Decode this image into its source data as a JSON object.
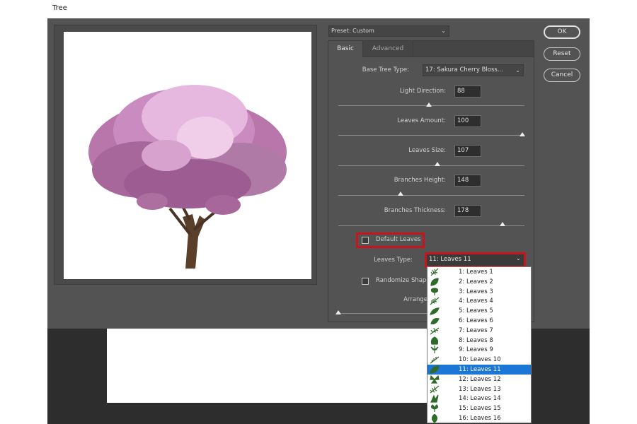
{
  "window": {
    "title": "Tree"
  },
  "buttons": {
    "ok": "OK",
    "reset": "Reset",
    "cancel": "Cancel"
  },
  "preset": {
    "label": "Preset: Custom"
  },
  "tabs": [
    {
      "label": "Basic",
      "active": true
    },
    {
      "label": "Advanced",
      "active": false
    }
  ],
  "basic": {
    "base_tree_type": {
      "label": "Base Tree Type:",
      "value": "17: Sakura Cherry Bloss..."
    },
    "sliders": [
      {
        "label": "Light Direction:",
        "value": "88"
      },
      {
        "label": "Leaves Amount:",
        "value": "100"
      },
      {
        "label": "Leaves Size:",
        "value": "107"
      },
      {
        "label": "Branches Height:",
        "value": "148"
      },
      {
        "label": "Branches Thickness:",
        "value": "178"
      }
    ],
    "default_leaves": {
      "label": "Default Leaves",
      "checked": false
    },
    "leaves_type": {
      "label": "Leaves Type:",
      "value": "11: Leaves 11"
    },
    "randomize": {
      "label": "Randomize Shape",
      "checked": false
    },
    "arrange": {
      "label": "Arrange"
    }
  },
  "leaves_options": [
    "1: Leaves 1",
    "2: Leaves 2",
    "3: Leaves 3",
    "4: Leaves 4",
    "5: Leaves 5",
    "6: Leaves 6",
    "7: Leaves 7",
    "8: Leaves 8",
    "9: Leaves 9",
    "10: Leaves 10",
    "11: Leaves 11",
    "12: Leaves 12",
    "13: Leaves 13",
    "14: Leaves 14",
    "15: Leaves 15",
    "16: Leaves 16"
  ],
  "selected_leaves_index": 10,
  "colors": {
    "highlight": "#c8141b",
    "selection": "#1c76d6",
    "leaf_icon": "#2f6b2a",
    "blossom": "#c98bc0",
    "trunk": "#5a3f2a"
  },
  "icons": {
    "dropdown": "chevron-down-icon",
    "leaf": "leaf-icon",
    "tree": "cherry-tree-image"
  }
}
